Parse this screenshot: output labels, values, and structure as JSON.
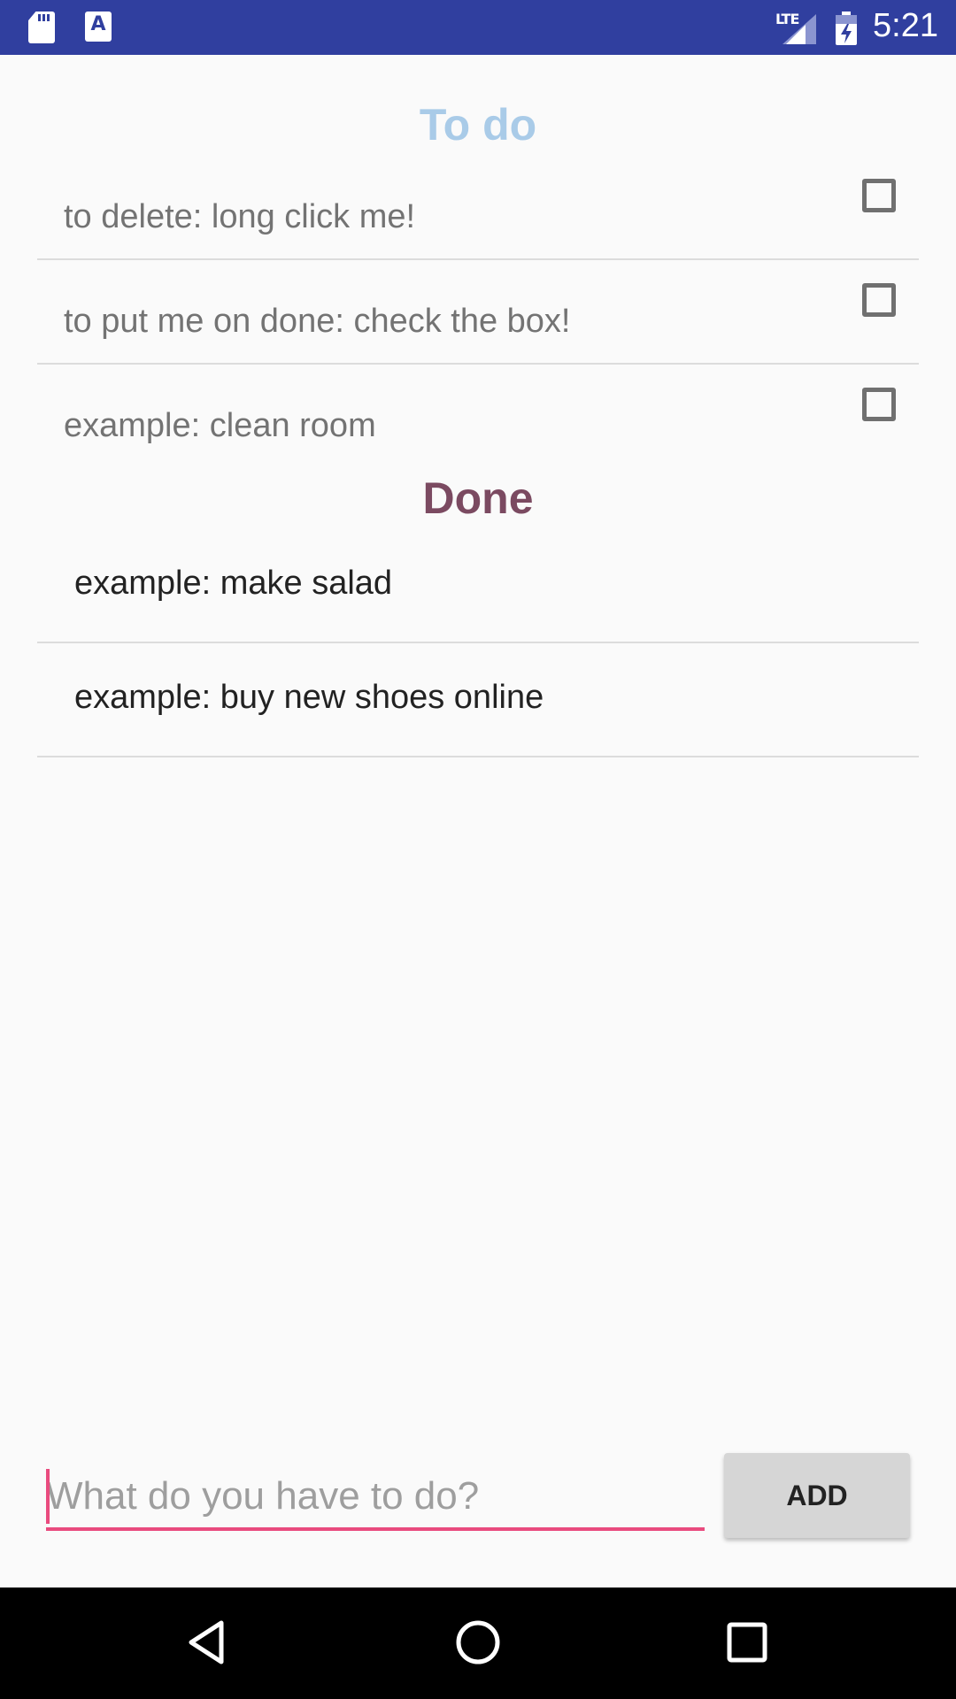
{
  "status_bar": {
    "network": "LTE",
    "time": "5:21",
    "icons": [
      "sd-card-icon",
      "a-icon",
      "signal-icon",
      "battery-charging-icon"
    ]
  },
  "todo": {
    "title": "To do",
    "title_color": "#a9cbe8",
    "items": [
      {
        "text": "to delete: long click me!",
        "checked": false
      },
      {
        "text": "to put me on done: check the box!",
        "checked": false
      },
      {
        "text": "example: clean room",
        "checked": false
      }
    ]
  },
  "done": {
    "title": "Done",
    "title_color": "#7b4a61",
    "items": [
      {
        "text": "example: make salad"
      },
      {
        "text": "example: buy new shoes online"
      }
    ]
  },
  "input": {
    "placeholder": "What do you have to do?",
    "value": ""
  },
  "add_button": {
    "label": "ADD"
  },
  "nav_bar": {
    "icons": [
      "back-icon",
      "home-icon",
      "recents-icon"
    ]
  },
  "colors": {
    "status_bar": "#303f9f",
    "accent": "#e94b7e"
  }
}
